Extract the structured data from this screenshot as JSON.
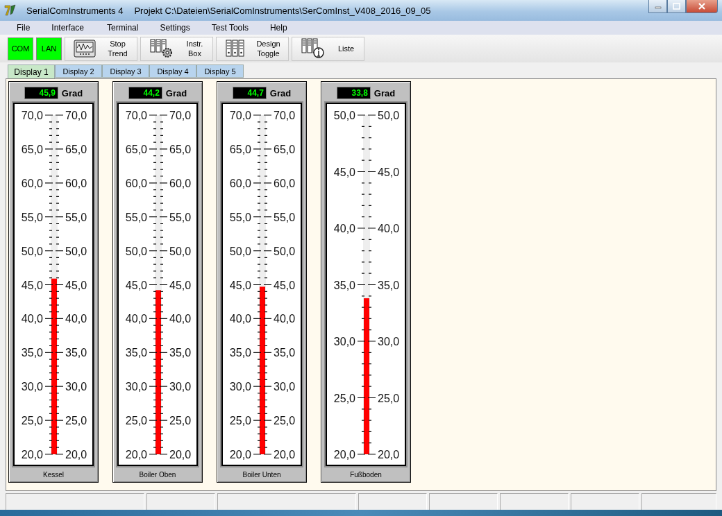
{
  "window": {
    "app_title": "SerialComInstruments 4",
    "project_title": "Projekt  C:\\Dateien\\SerialComInstruments\\SerComInst_V408_2016_09_05"
  },
  "menu": [
    "File",
    "Interface",
    "Terminal",
    "Settings",
    "Test Tools",
    "Help"
  ],
  "toolbar": [
    {
      "kind": "status",
      "label": "COM",
      "on": true
    },
    {
      "kind": "status",
      "label": "LAN",
      "on": true
    },
    {
      "kind": "tool",
      "lines": [
        "Stop",
        "Trend"
      ]
    },
    {
      "kind": "tool",
      "lines": [
        "Instr.",
        "Box"
      ]
    },
    {
      "kind": "tool",
      "lines": [
        "Design",
        "Toggle"
      ]
    },
    {
      "kind": "tool",
      "lines": [
        "Liste"
      ]
    }
  ],
  "tabs": [
    {
      "label": "Display 1",
      "selected": true
    },
    {
      "label": "Display 2",
      "selected": false
    },
    {
      "label": "Display 3",
      "selected": false
    },
    {
      "label": "Display 4",
      "selected": false
    },
    {
      "label": "Display 5",
      "selected": false
    }
  ],
  "gauges": [
    {
      "reading": "45,9",
      "unit": "Grad",
      "level": 0.518,
      "left_labels": [
        "70,0",
        "65,0",
        "60,0",
        "55,0",
        "50,0",
        "45,0",
        "40,0",
        "35,0",
        "30,0",
        "25,0",
        "20,0"
      ],
      "right_labels": [
        "70,0",
        "65,0",
        "60,0",
        "55,0",
        "50,0",
        "45,0",
        "40,0",
        "35,0",
        "30,0",
        "25,0",
        "20,0"
      ],
      "caption": "Kessel"
    },
    {
      "reading": "44,2",
      "unit": "Grad",
      "level": 0.484,
      "left_labels": [
        "70,0",
        "65,0",
        "60,0",
        "55,0",
        "50,0",
        "45,0",
        "40,0",
        "35,0",
        "30,0",
        "25,0",
        "20,0"
      ],
      "right_labels": [
        "70,0",
        "65,0",
        "60,0",
        "55,0",
        "50,0",
        "45,0",
        "40,0",
        "35,0",
        "30,0",
        "25,0",
        "20,0"
      ],
      "caption": "Boiler Oben"
    },
    {
      "reading": "44,7",
      "unit": "Grad",
      "level": 0.494,
      "left_labels": [
        "70,0",
        "65,0",
        "60,0",
        "55,0",
        "50,0",
        "45,0",
        "40,0",
        "35,0",
        "30,0",
        "25,0",
        "20,0"
      ],
      "right_labels": [
        "70,0",
        "65,0",
        "60,0",
        "55,0",
        "50,0",
        "45,0",
        "40,0",
        "35,0",
        "30,0",
        "25,0",
        "20,0"
      ],
      "caption": "Boiler Unten"
    },
    {
      "reading": "33,8",
      "unit": "Grad",
      "level": 0.46,
      "left_labels": [
        "50,0",
        "45,0",
        "40,0",
        "35,0",
        "30,0",
        "25,0",
        "20,0"
      ],
      "right_labels": [
        "50,0",
        "45,0",
        "40,0",
        "35,0",
        "30,0",
        "25,0",
        "20,0"
      ],
      "caption": "Fußboden"
    }
  ]
}
